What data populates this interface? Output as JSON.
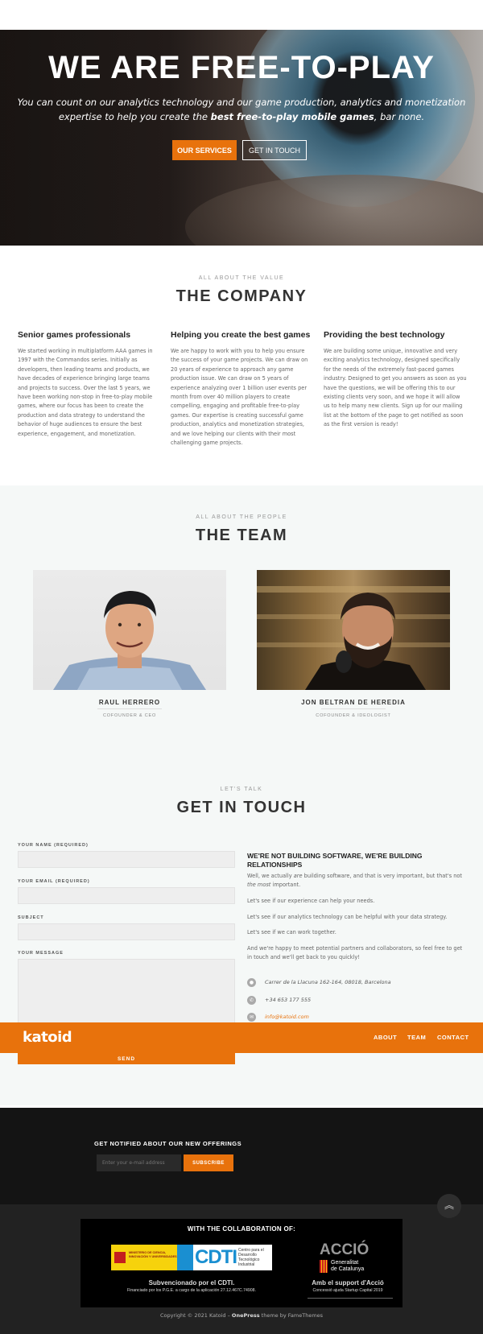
{
  "hero": {
    "title": "WE ARE FREE-TO-PLAY",
    "subtitle_part1": "You can count on our analytics technology and our game production, analytics and monetization expertise to help you create the ",
    "subtitle_bold": "best free-to-play mobile games",
    "subtitle_part2": ", bar none.",
    "btn_services": "OUR SERVICES",
    "btn_touch": "GET IN TOUCH"
  },
  "company": {
    "kicker": "ALL ABOUT THE VALUE",
    "title": "THE COMPANY",
    "columns": [
      {
        "title": "Senior games professionals",
        "text": "We started working in multiplatform AAA games in 1997 with the Commandos series. Initially as developers, then leading teams and products, we have decades of experience bringing large teams and projects to success. Over the last 5 years, we have been working non-stop in free-to-play mobile games, where our focus has been to create the production and data strategy to understand the behavior of huge audiences to ensure the best experience, engagement, and monetization."
      },
      {
        "title": "Helping you create the best games",
        "text": "We are happy to work with you to help you ensure the success of your game projects. We can draw on 20 years of experience to approach any game production issue. We can draw on 5 years of experience analyzing over 1 billion user events per month from over 40 million players to create compelling, engaging and profitable free-to-play games. Our expertise is creating successful game production, analytics and monetization strategies, and we love helping our clients with their most challenging game projects."
      },
      {
        "title": "Providing the best technology",
        "text": "We are building some unique, innovative and very exciting analytics technology, designed specifically for the needs of the extremely fast-paced games industry. Designed to get you answers as soon as you have the questions, we will be offering this to our existing clients very soon, and we hope it will allow us to help many new clients. Sign up for our mailing list at the bottom of the page to get notified as soon as the first version is ready!"
      }
    ]
  },
  "team": {
    "kicker": "ALL ABOUT THE PEOPLE",
    "title": "THE TEAM",
    "members": [
      {
        "name": "RAUL HERRERO",
        "role": "COFOUNDER & CEO"
      },
      {
        "name": "JON BELTRAN DE HEREDIA",
        "role": "COFOUNDER & IDEOLOGIST"
      }
    ]
  },
  "contact": {
    "kicker": "LET'S TALK",
    "title": "GET IN TOUCH",
    "labels": {
      "name": "YOUR NAME (REQUIRED)",
      "email": "YOUR EMAIL (REQUIRED)",
      "subject": "SUBJECT",
      "message": "YOUR MESSAGE"
    },
    "send": "SEND",
    "right_title": "WE'RE NOT BUILDING SOFTWARE, WE'RE BUILDING RELATIONSHIPS",
    "p1_a": "Well, we actually ",
    "p1_em1": "are",
    "p1_b": " building software, and that is very important, but that's not ",
    "p1_em2": "the most",
    "p1_c": " important.",
    "p2": "Let's see if our experience can help your needs.",
    "p3": "Let's see if our analytics technology can be helpful with your data strategy.",
    "p4": "Let's see if we can work together.",
    "p5": "And we're happy to meet potential partners and collaborators, so feel free to get in touch and we'll get back to you quickly!",
    "address": "Carrer de la Llacuna 162-164, 08018, Barcelona",
    "phone": "+34 653 177 555",
    "email": "info@katoid.com"
  },
  "nav": {
    "logo": "katoid",
    "links": [
      "ABOUT",
      "TEAM",
      "CONTACT"
    ]
  },
  "newsletter": {
    "title": "GET NOTIFIED ABOUT OUR NEW OFFERINGS",
    "placeholder": "Enter your e-mail address",
    "button": "SUBSCRIBE"
  },
  "collab": {
    "title": "WITH THE COLLABORATION OF:",
    "ministry": "MINISTERIO DE CIENCIA, INNOVACIÓN Y UNIVERSIDADES",
    "cdti_logo": "CDTI",
    "cdti_desc": "Centro para el Desarrollo Tecnológico Industrial",
    "cdti_line1": "Subvencionado por el CDTI.",
    "cdti_line2": "Financiado por los P.G.E. a cargo de la aplicación 27.12.467C.74908.",
    "accio_logo": "ACCIÓ",
    "accio_gen1": "Generalitat",
    "accio_gen2": "de Catalunya",
    "accio_line1": "Amb el support d'Acció",
    "accio_line2": "Concessió ajuda Startup Capital 2019"
  },
  "footer": {
    "copy_a": "Copyright © 2021 Katoid – ",
    "copy_theme": "OnePress",
    "copy_b": " theme by FameThemes"
  },
  "colors": {
    "accent": "#e8720c",
    "dark": "#141414",
    "team_bg": "#f5f8f7"
  }
}
